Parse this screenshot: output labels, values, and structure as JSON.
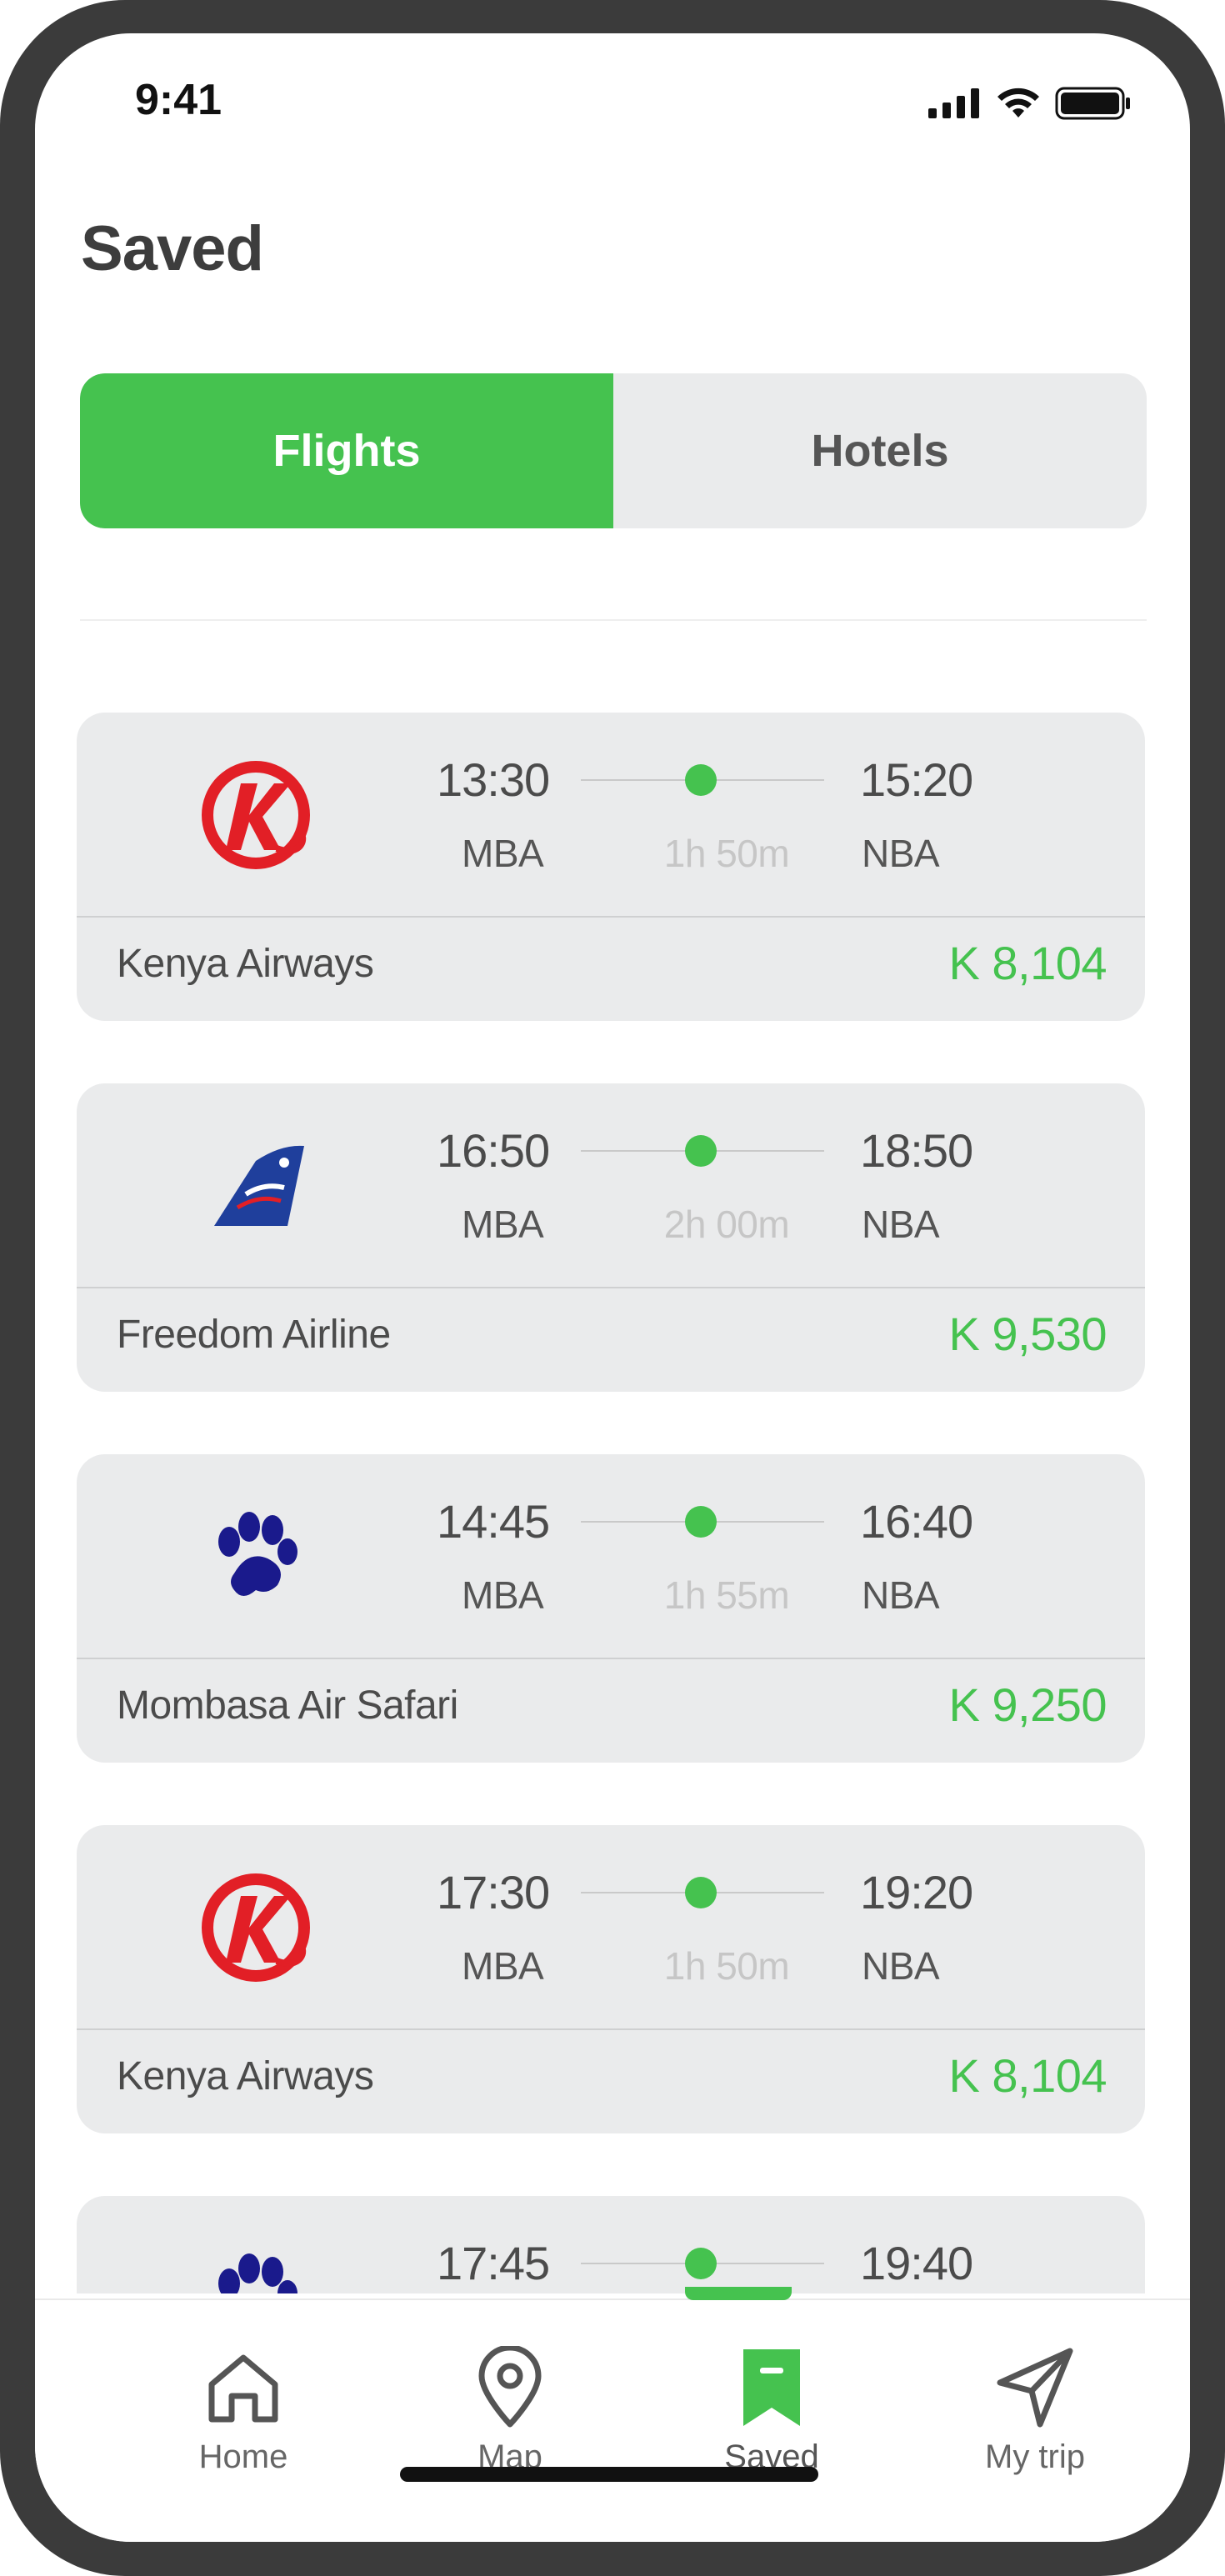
{
  "status_bar": {
    "time": "9:41"
  },
  "page": {
    "title": "Saved"
  },
  "tabs_segment": {
    "flights": "Flights",
    "hotels": "Hotels",
    "selected": "Flights"
  },
  "colors": {
    "accent": "#45c24f",
    "card_bg": "#eaebec",
    "text_dark": "#4b4b4b",
    "duration_gray": "#c6c6c6"
  },
  "flights": [
    {
      "airline": "Kenya Airways",
      "logo": "kenya-airways-logo",
      "dep_time": "13:30",
      "arr_time": "15:20",
      "dep_code": "MBA",
      "arr_code": "NBA",
      "duration": "1h 50m",
      "price": "K 8,104"
    },
    {
      "airline": "Freedom Airline",
      "logo": "freedom-airline-logo",
      "dep_time": "16:50",
      "arr_time": "18:50",
      "dep_code": "MBA",
      "arr_code": "NBA",
      "duration": "2h 00m",
      "price": "K 9,530"
    },
    {
      "airline": "Mombasa Air Safari",
      "logo": "paw-logo",
      "dep_time": "14:45",
      "arr_time": "16:40",
      "dep_code": "MBA",
      "arr_code": "NBA",
      "duration": "1h 55m",
      "price": "K 9,250"
    },
    {
      "airline": "Kenya Airways",
      "logo": "kenya-airways-logo",
      "dep_time": "17:30",
      "arr_time": "19:20",
      "dep_code": "MBA",
      "arr_code": "NBA",
      "duration": "1h 50m",
      "price": "K 8,104"
    },
    {
      "logo": "paw-logo",
      "dep_time": "17:45",
      "arr_time": "19:40"
    }
  ],
  "nav": {
    "items": [
      {
        "label": "Home",
        "icon": "home-icon"
      },
      {
        "label": "Map",
        "icon": "map-pin-icon"
      },
      {
        "label": "Saved",
        "icon": "bookmark-icon"
      },
      {
        "label": "My trip",
        "icon": "send-icon"
      }
    ],
    "active": "Saved"
  }
}
